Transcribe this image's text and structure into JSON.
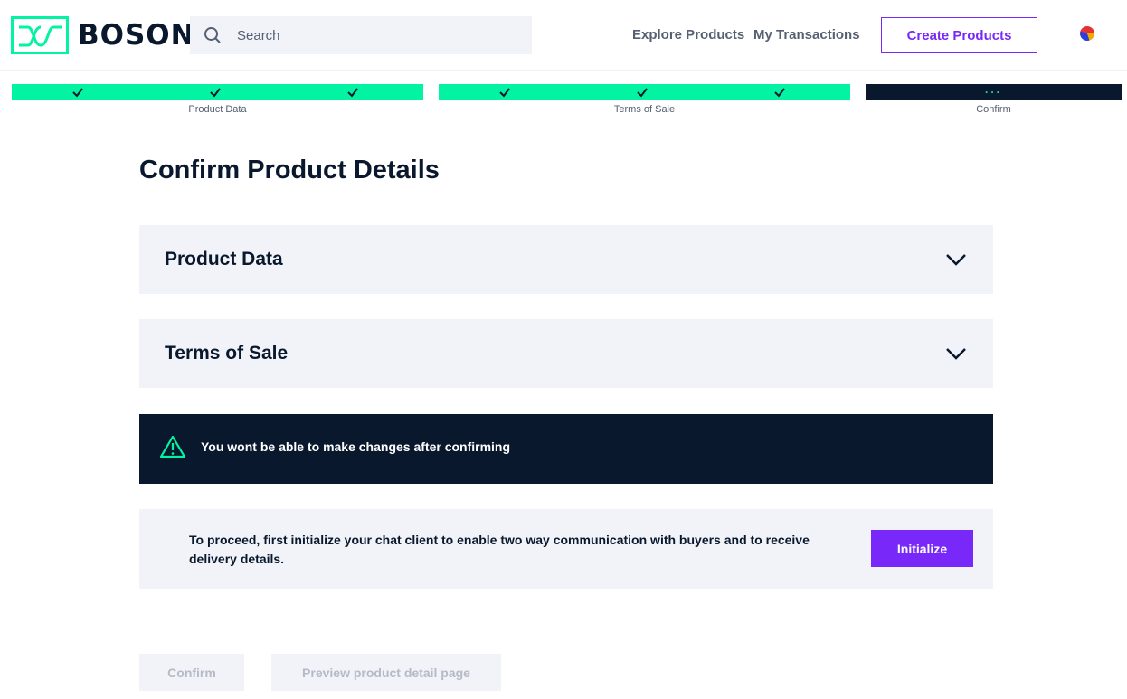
{
  "header": {
    "logo_text": "BOSON",
    "search_placeholder": "Search",
    "nav": {
      "explore": "Explore Products",
      "transactions": "My Transactions"
    },
    "create_button": "Create Products"
  },
  "steps": [
    {
      "label": "Product Data",
      "status": "done"
    },
    {
      "label": "Terms of Sale",
      "status": "done"
    },
    {
      "label": "Confirm",
      "status": "active",
      "indicator": "..."
    }
  ],
  "page_title": "Confirm Product Details",
  "sections": [
    {
      "title": "Product Data",
      "icon": "chevron-down-icon"
    },
    {
      "title": "Terms of Sale",
      "icon": "chevron-down-icon"
    }
  ],
  "warning": {
    "icon": "warning-triangle-icon",
    "text": "You wont be able to make changes after confirming"
  },
  "chat_notice": {
    "text": "To proceed, first initialize your chat client to enable two way communication with buyers and to receive delivery details.",
    "button": "Initialize"
  },
  "actions": {
    "confirm": "Confirm",
    "preview": "Preview product detail page"
  },
  "colors": {
    "accent_green": "#02f3a2",
    "brand_purple": "#7829f9",
    "dark_navy": "#09182c",
    "panel_grey": "#f1f3f9"
  }
}
